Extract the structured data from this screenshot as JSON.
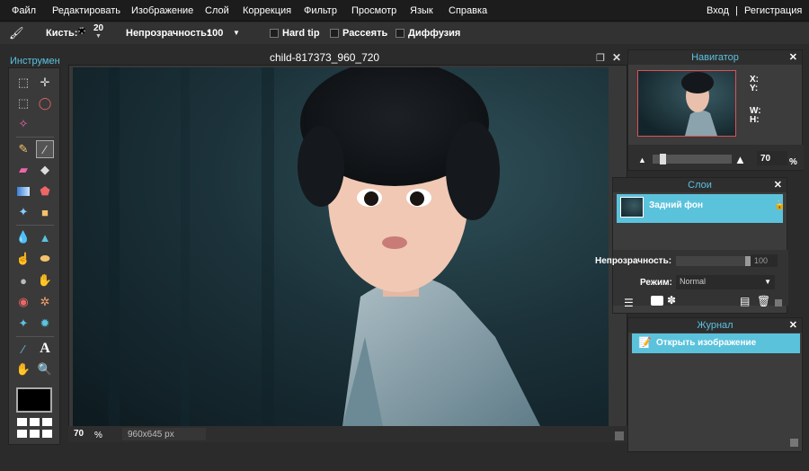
{
  "menu": [
    "Файл",
    "Редактировать",
    "Изображение",
    "Слой",
    "Коррекция",
    "Фильтр",
    "Просмотр",
    "Язык",
    "Справка"
  ],
  "auth": {
    "login": "Вход",
    "separator": "|",
    "register": "Регистрация"
  },
  "toolbar": {
    "brush_label": "Кисть:",
    "brush_size": "20",
    "opacity_label": "Непрозрачность:",
    "opacity_value": "100",
    "hardtip_label": "Hard tip",
    "scatter_label": "Рассеять",
    "diffusion_label": "Диффузия"
  },
  "tools_panel": {
    "title": "Инструменты"
  },
  "document": {
    "title": "child-817373_960_720",
    "zoom": "70",
    "zoom_unit": "%",
    "size": "960x645 px"
  },
  "navigator": {
    "title": "Навигатор",
    "x_label": "X:",
    "y_label": "Y:",
    "w_label": "W:",
    "h_label": "H:",
    "zoom_value": "70",
    "zoom_unit": "%",
    "slider_level": 0.1
  },
  "layers": {
    "title": "Слои",
    "layer_name": "Задний фон",
    "opacity_label": "Непрозрачность:",
    "opacity_value": "100",
    "mode_label": "Режим:",
    "mode_value": "Normal"
  },
  "history": {
    "title": "Журнал",
    "items": [
      "Открыть изображение"
    ]
  },
  "colors": {
    "accent": "#5bc2dc",
    "foreground": "#000000",
    "background": "#ffffff"
  },
  "icons": [
    "crop-icon",
    "move-icon",
    "marquee-icon",
    "lasso-icon",
    "magic-wand-icon",
    "pencil-icon",
    "brush-icon",
    "eraser-icon",
    "fill-icon",
    "gradient-icon",
    "stamp-icon",
    "color-replace-icon",
    "shapes-icon",
    "blur-icon",
    "sharpen-icon",
    "smudge-icon",
    "sponge-icon",
    "dodge-icon",
    "burn-icon",
    "redeye-icon",
    "spot-heal-icon",
    "bloat-icon",
    "pinch-icon",
    "eyedropper-icon",
    "text-icon",
    "hand-icon",
    "zoom-icon"
  ]
}
